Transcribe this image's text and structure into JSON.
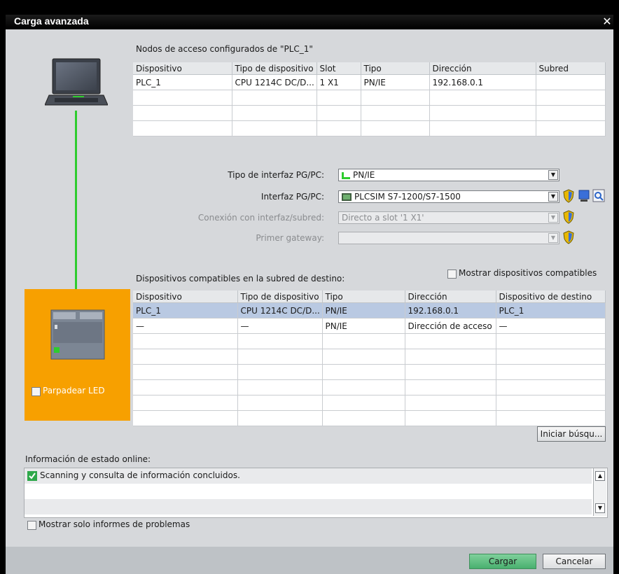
{
  "window": {
    "title": "Carga avanzada",
    "close_glyph": "✕"
  },
  "configured": {
    "heading": "Nodos de acceso configurados de \"PLC_1\"",
    "columns": [
      "Dispositivo",
      "Tipo de dispositivo",
      "Slot",
      "Tipo",
      "Dirección",
      "Subred"
    ],
    "rows": [
      [
        "PLC_1",
        "CPU 1214C DC/D...",
        "1 X1",
        "PN/IE",
        "192.168.0.1",
        ""
      ]
    ]
  },
  "interface": {
    "pgpc_type_label": "Tipo de interfaz PG/PC:",
    "pgpc_type_value": "PN/IE",
    "pgpc_iface_label": "Interfaz PG/PC:",
    "pgpc_iface_value": "PLCSIM S7-1200/S7-1500",
    "subnet_label": "Conexión con interfaz/subred:",
    "subnet_value": "Directo a slot '1 X1'",
    "gateway_label": "Primer gateway:",
    "gateway_value": ""
  },
  "compatible": {
    "heading": "Dispositivos compatibles en la subred de destino:",
    "show_all_label": "Mostrar dispositivos compatibles",
    "columns": [
      "Dispositivo",
      "Tipo de dispositivo",
      "Tipo",
      "Dirección",
      "Dispositivo de destino"
    ],
    "rows": [
      [
        "PLC_1",
        "CPU 1214C DC/D...",
        "PN/IE",
        "192.168.0.1",
        "PLC_1"
      ],
      [
        "—",
        "—",
        "PN/IE",
        "Dirección de acceso",
        "—"
      ]
    ]
  },
  "flash_led_label": "Parpadear LED",
  "search_button": "Iniciar búsqu...",
  "status": {
    "heading": "Información de estado online:",
    "message": "Scanning y consulta de información concluidos.",
    "problems_only_label": "Mostrar solo informes de problemas"
  },
  "footer": {
    "load_button": "Cargar",
    "cancel_button": "Cancelar"
  },
  "colors": {
    "accent_orange": "#f7a000",
    "link_green": "#2ecc2e",
    "selection": "#b9c9e2"
  }
}
